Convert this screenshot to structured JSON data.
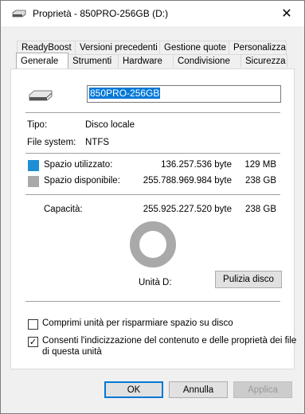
{
  "window": {
    "title": "Proprietà - 850PRO-256GB (D:)",
    "close_glyph": "✕"
  },
  "tabs": {
    "row1": [
      "ReadyBoost",
      "Versioni precedenti",
      "Gestione quote",
      "Personalizza"
    ],
    "row2": [
      "Generale",
      "Strumenti",
      "Hardware",
      "Condivisione",
      "Sicurezza"
    ],
    "active": "Generale"
  },
  "general": {
    "drive_name": "850PRO-256GB",
    "type_label": "Tipo:",
    "type_value": "Disco locale",
    "fs_label": "File system:",
    "fs_value": "NTFS",
    "used_label": "Spazio utilizzato:",
    "used_bytes": "136.257.536 byte",
    "used_size": "129 MB",
    "used_color": "#1e8fd6",
    "free_label": "Spazio disponibile:",
    "free_bytes": "255.788.969.984 byte",
    "free_size": "238 GB",
    "free_color": "#a9a9a9",
    "capacity_label": "Capacità:",
    "capacity_bytes": "255.925.227.520 byte",
    "capacity_size": "238 GB",
    "drive_label": "Unità D:",
    "cleanup_button": "Pulizia disco",
    "compress_label": "Comprimi unità per risparmiare spazio su disco",
    "compress_checked": false,
    "index_label_line1": "Consenti l'indicizzazione del contenuto e delle proprietà dei file",
    "index_label_line2": "di questa unità",
    "index_checked": true
  },
  "buttons": {
    "ok": "OK",
    "cancel": "Annulla",
    "apply": "Applica"
  }
}
